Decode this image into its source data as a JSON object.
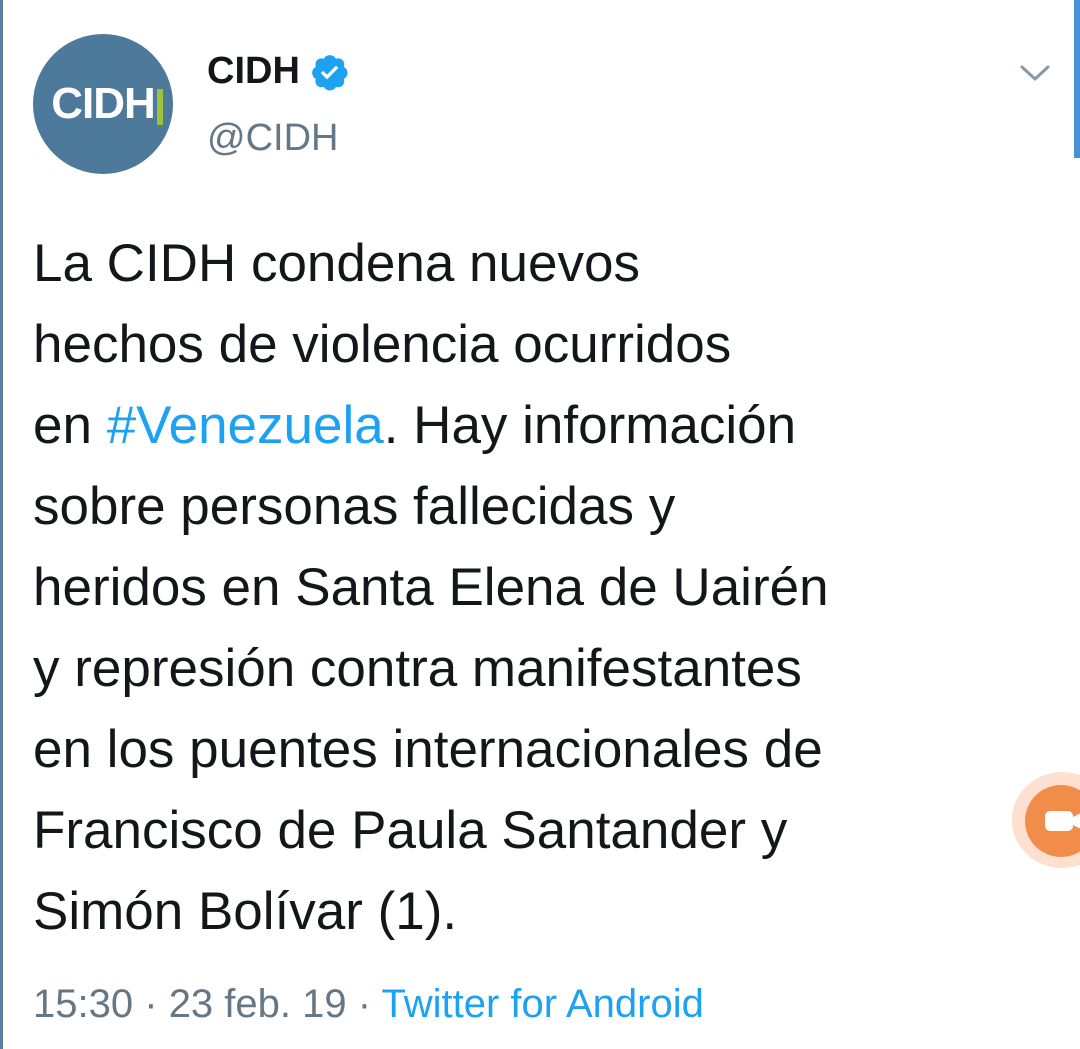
{
  "tweet": {
    "display_name": "CIDH",
    "handle": "@CIDH",
    "avatar_text": "CIDH",
    "verified": true,
    "text_lines": [
      {
        "before": "La CIDH condena nuevos",
        "hashtag": "",
        "after": ""
      },
      {
        "before": "hechos de violencia ocurridos",
        "hashtag": "",
        "after": ""
      },
      {
        "before": "en ",
        "hashtag": "#Venezuela",
        "after": ". Hay información"
      },
      {
        "before": "sobre personas fallecidas y",
        "hashtag": "",
        "after": ""
      },
      {
        "before": "heridos en Santa Elena de Uairén",
        "hashtag": "",
        "after": ""
      },
      {
        "before": "y represión contra manifestantes",
        "hashtag": "",
        "after": ""
      },
      {
        "before": "en los puentes internacionales de",
        "hashtag": "",
        "after": ""
      },
      {
        "before": "Francisco de Paula Santander y",
        "hashtag": "",
        "after": ""
      },
      {
        "before": "Simón Bolívar (1).",
        "hashtag": "",
        "after": ""
      }
    ],
    "time": "15:30",
    "date": "23 feb. 19",
    "separator": "·",
    "source": "Twitter for Android"
  },
  "icons": {
    "verified": "verified-badge-icon",
    "more": "chevron-down-icon",
    "float": "camera-icon"
  },
  "colors": {
    "link": "#1da1f2",
    "secondary_text": "#657786",
    "avatar_bg": "#4d7a9b",
    "avatar_accent": "#9ac43c",
    "float_button": "#f28c4b"
  }
}
